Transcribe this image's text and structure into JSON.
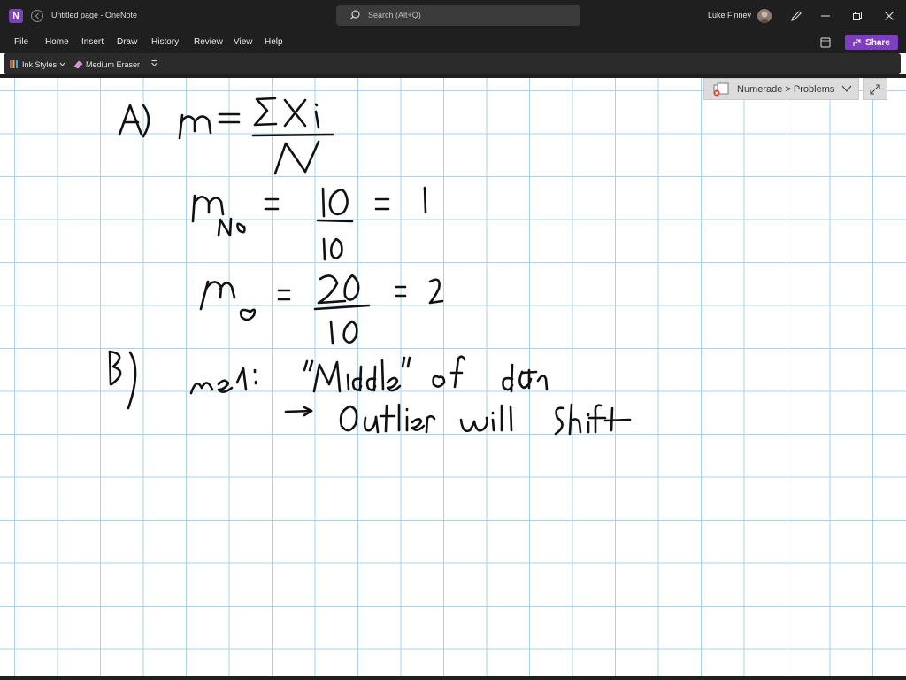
{
  "window": {
    "doc_title": "Untitled page - OneNote",
    "search_placeholder": "Search (Alt+Q)",
    "user_name": "Luke Finney",
    "app_icon_letter": "N"
  },
  "ribbon": {
    "tabs": [
      "File",
      "Home",
      "Insert",
      "Draw",
      "History",
      "Review",
      "View",
      "Help"
    ],
    "share_label": "Share"
  },
  "toolbar": {
    "ink_styles_label": "Ink Styles",
    "eraser_label": "Medium Eraser"
  },
  "notebook_nav": {
    "label": "Numerade > Problems"
  },
  "handwritten_notes": [
    "A)",
    "μ = Σ Xi / N",
    "μNO = 10 / 10 = 1",
    "μO = 20 / 10 = 2",
    "B)",
    "mean: \"Middle\" of data",
    "→ Outlier will shift"
  ],
  "colors": {
    "titlebar_bg": "#1f1f1f",
    "share_button": "#7b3fc0",
    "grid_line": "#a8d3ec",
    "ink": "#111111"
  },
  "icons": {
    "app": "onenote-icon",
    "back": "back-arrow-icon",
    "search": "search-icon",
    "pen": "pen-icon",
    "minimize": "minimize-icon",
    "restore": "restore-icon",
    "close": "close-icon",
    "sticky": "sticky-notes-icon",
    "share": "share-icon",
    "ink_styles": "pen-styles-icon",
    "eraser": "eraser-icon",
    "more": "more-chevron-icon",
    "expand": "expand-icon"
  }
}
